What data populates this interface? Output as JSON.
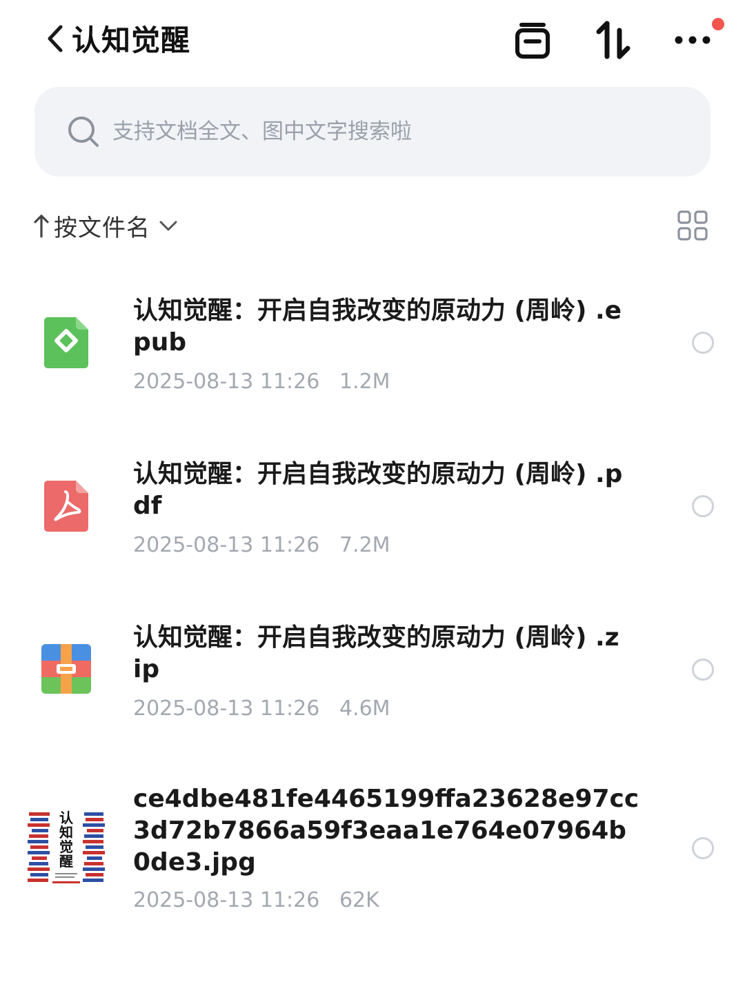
{
  "header": {
    "title": "认知觉醒",
    "back_icon": "chevron-left-icon",
    "actions": [
      "window-icon",
      "sort-arrows-icon",
      "more-icon"
    ],
    "notification_color": "#f2564f"
  },
  "search": {
    "placeholder": "支持文档全文、图中文字搜索啦"
  },
  "sort": {
    "label": "按文件名",
    "direction_icon": "arrow-up-icon",
    "dropdown_icon": "chevron-down-icon",
    "view_toggle_icon": "grid-view-icon"
  },
  "files": [
    {
      "name": "认知觉醒：开启自我改变的原动力 (周岭) .epub",
      "date": "2025-08-13 11:26",
      "size": "1.2M",
      "type": "epub",
      "icon_color": "#5cc15a"
    },
    {
      "name": "认知觉醒：开启自我改变的原动力 (周岭) .pdf",
      "date": "2025-08-13 11:26",
      "size": "7.2M",
      "type": "pdf",
      "icon_color": "#ec6a6a"
    },
    {
      "name": "认知觉醒：开启自我改变的原动力 (周岭) .zip",
      "date": "2025-08-13 11:26",
      "size": "4.6M",
      "type": "zip",
      "icon_color": "#4a90e2"
    },
    {
      "name": "ce4dbe481fe4465199ffa23628e97cc3d72b7866a59f3eaa1e764e07964b0de3.jpg",
      "date": "2025-08-13 11:26",
      "size": "62K",
      "type": "jpg",
      "thumbnail_title": "认知觉醒"
    }
  ]
}
